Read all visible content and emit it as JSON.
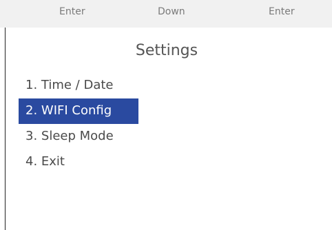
{
  "buttons": {
    "left": "Enter",
    "middle": "Down",
    "right": "Enter"
  },
  "screen": {
    "title": "Settings",
    "menu": [
      {
        "label": "1. Time / Date",
        "selected": false
      },
      {
        "label": "2. WIFI Config",
        "selected": true
      },
      {
        "label": "3. Sleep Mode",
        "selected": false
      },
      {
        "label": "4. Exit",
        "selected": false
      }
    ]
  },
  "colors": {
    "selection_background": "#2a4aa0",
    "selection_text": "#ffffff",
    "button_bar_background": "#f1f1f1"
  }
}
